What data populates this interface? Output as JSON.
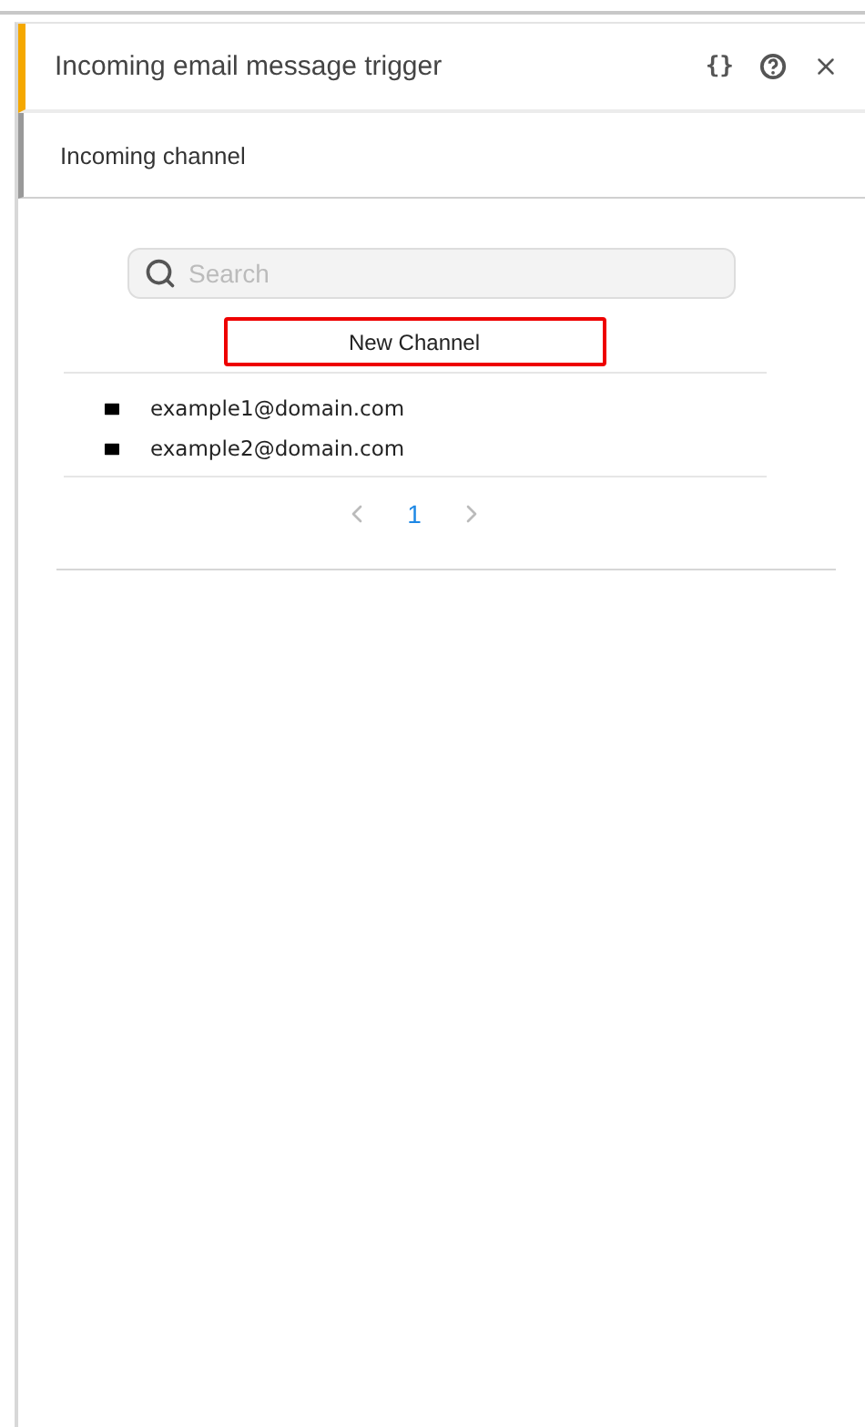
{
  "panel": {
    "title": "Incoming email message trigger",
    "code_button": "{}"
  },
  "section": {
    "title": "Incoming channel"
  },
  "search": {
    "placeholder": "Search"
  },
  "new_channel_button": {
    "label": "New Channel",
    "highlighted": true
  },
  "channels": [
    {
      "address": "example1@domain.com"
    },
    {
      "address": "example2@domain.com"
    }
  ],
  "pagination": {
    "prev_disabled": true,
    "next_disabled": true,
    "pages": [
      {
        "label": "1",
        "selected": true
      }
    ]
  }
}
